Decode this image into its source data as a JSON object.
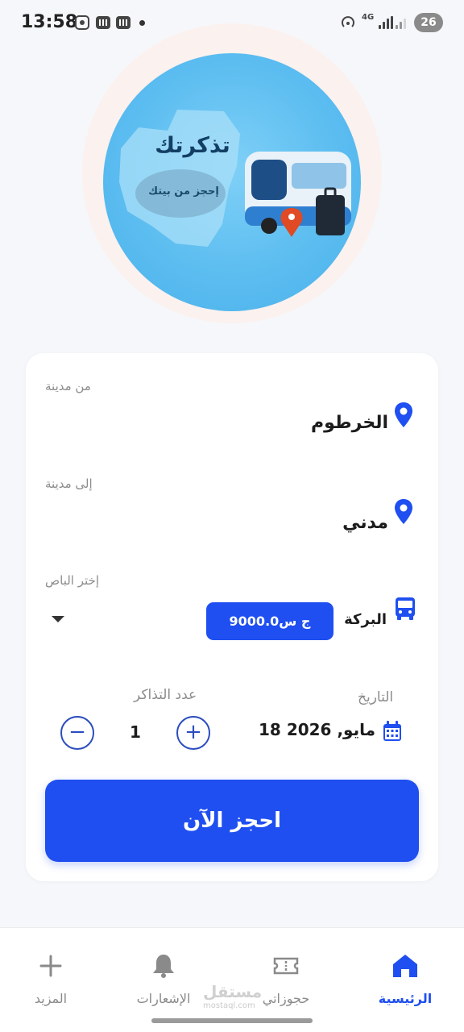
{
  "status_bar": {
    "time": "13:58",
    "network": "4G",
    "battery": "26"
  },
  "hero": {
    "brand_title": "تذكرتك",
    "brand_subtitle": "إحجز من بيتك"
  },
  "form": {
    "from": {
      "label": "من مدينة",
      "value": "الخرطوم",
      "icon": "location-pin-icon"
    },
    "to": {
      "label": "إلى مدينة",
      "value": "مدني",
      "icon": "location-pin-icon"
    },
    "bus": {
      "label": "إختر الباص",
      "name": "البركة",
      "price": "9000.0ج س",
      "icon": "bus-icon"
    },
    "tickets": {
      "label": "عدد التذاكر",
      "count": "1",
      "decrement": "−",
      "increment": "+"
    },
    "date": {
      "label": "التاريخ",
      "value": "18 مايو, 2026",
      "icon": "calendar-icon"
    },
    "book_label": "احجز الآن"
  },
  "bottom_nav": {
    "items": [
      {
        "label": "الرئيسية",
        "icon": "home-icon",
        "active": true
      },
      {
        "label": "حجوزاتي",
        "icon": "ticket-icon",
        "active": false
      },
      {
        "label": "الإشعارات",
        "icon": "bell-icon",
        "active": false
      },
      {
        "label": "المزيد",
        "icon": "plus-icon",
        "active": false
      }
    ]
  },
  "watermark": {
    "text": "مستقل",
    "sub": "mostaql.com"
  },
  "colors": {
    "accent": "#1f4ff0",
    "background": "#f6f7fb",
    "card": "#ffffff",
    "hero_blue": "#5cbdf0"
  }
}
